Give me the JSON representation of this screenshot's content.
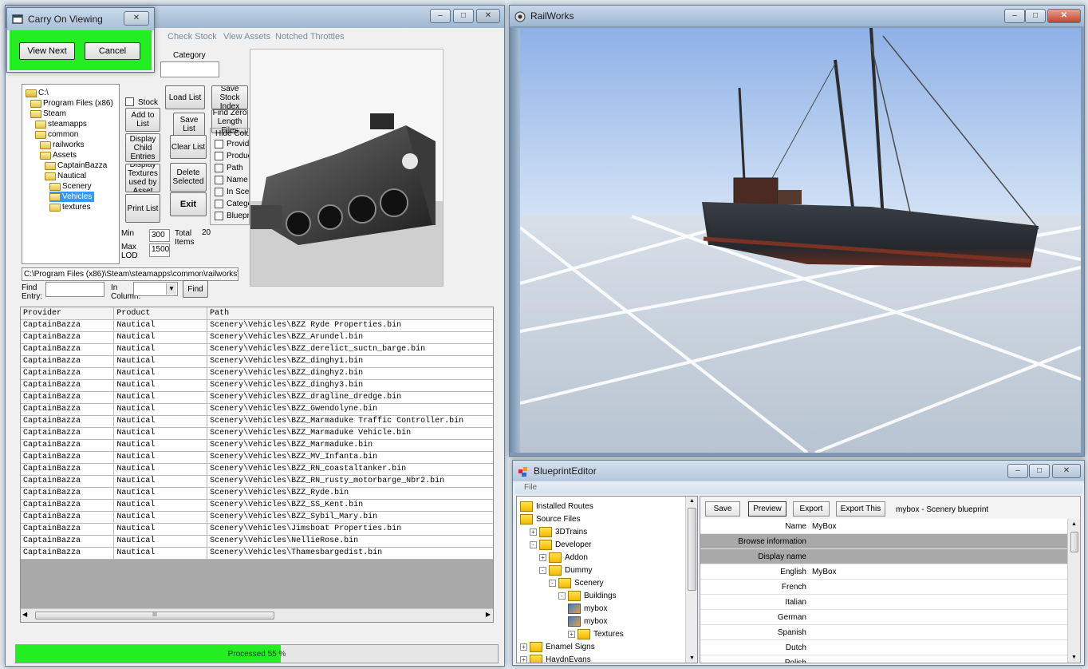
{
  "carry_dialog": {
    "title": "Carry On Viewing",
    "close_glyph": "✕",
    "view_next": "View Next",
    "cancel": "Cancel"
  },
  "main_window": {
    "menu": [
      "Check Stock",
      "View Assets",
      "Notched Throttles"
    ],
    "category_label": "Category",
    "category_value": "",
    "tree": [
      {
        "label": "C:\\",
        "indent": 0
      },
      {
        "label": "Program Files (x86)",
        "indent": 1
      },
      {
        "label": "Steam",
        "indent": 1
      },
      {
        "label": "steamapps",
        "indent": 2
      },
      {
        "label": "common",
        "indent": 2
      },
      {
        "label": "railworks",
        "indent": 3
      },
      {
        "label": "Assets",
        "indent": 3
      },
      {
        "label": "CaptainBazza",
        "indent": 4
      },
      {
        "label": "Nautical",
        "indent": 4
      },
      {
        "label": "Scenery",
        "indent": 5
      },
      {
        "label": "Vehicles",
        "indent": 5,
        "selected": true
      },
      {
        "label": "textures",
        "indent": 5
      }
    ],
    "stock_label": "Stock",
    "buttons": {
      "add_to_list": "Add to List",
      "display_child_entries": "Display Child Entries",
      "display_textures": "Display Textures used by Asset",
      "print_list": "Print List",
      "load_list": "Load List",
      "save_list": "Save List",
      "clear_list": "Clear List",
      "delete_selected": "Delete Selected",
      "exit": "Exit",
      "save_stock_index": "Save Stock Index",
      "find_zero_length": "Find Zero Length Files",
      "find": "Find"
    },
    "hide_columns": {
      "title": "Hide Columns",
      "items": [
        "Provider",
        "Product",
        "Path",
        "Name",
        "In Scenario",
        "Category",
        "Blueprint"
      ]
    },
    "min_label": "Min",
    "min_value": "300",
    "total_label": "Total Items",
    "total_value": "20",
    "max_lod_label": "Max LOD",
    "max_lod_value": "1500",
    "path_value": "C:\\Program Files (x86)\\Steam\\steamapps\\common\\railworks\\Assets",
    "find_entry_label": "Find Entry:",
    "find_entry_value": "",
    "in_column_label": "In Column:",
    "in_column_value": "",
    "table": {
      "headers": [
        "Provider",
        "Product",
        "Path"
      ],
      "rows": [
        [
          "CaptainBazza",
          "Nautical",
          "Scenery\\Vehicles\\BZZ Ryde Properties.bin"
        ],
        [
          "CaptainBazza",
          "Nautical",
          "Scenery\\Vehicles\\BZZ_Arundel.bin"
        ],
        [
          "CaptainBazza",
          "Nautical",
          "Scenery\\Vehicles\\BZZ_derelict_suctn_barge.bin"
        ],
        [
          "CaptainBazza",
          "Nautical",
          "Scenery\\Vehicles\\BZZ_dinghy1.bin"
        ],
        [
          "CaptainBazza",
          "Nautical",
          "Scenery\\Vehicles\\BZZ_dinghy2.bin"
        ],
        [
          "CaptainBazza",
          "Nautical",
          "Scenery\\Vehicles\\BZZ_dinghy3.bin"
        ],
        [
          "CaptainBazza",
          "Nautical",
          "Scenery\\Vehicles\\BZZ_dragline_dredge.bin"
        ],
        [
          "CaptainBazza",
          "Nautical",
          "Scenery\\Vehicles\\BZZ_Gwendolyne.bin"
        ],
        [
          "CaptainBazza",
          "Nautical",
          "Scenery\\Vehicles\\BZZ_Marmaduke Traffic Controller.bin"
        ],
        [
          "CaptainBazza",
          "Nautical",
          "Scenery\\Vehicles\\BZZ_Marmaduke Vehicle.bin"
        ],
        [
          "CaptainBazza",
          "Nautical",
          "Scenery\\Vehicles\\BZZ_Marmaduke.bin"
        ],
        [
          "CaptainBazza",
          "Nautical",
          "Scenery\\Vehicles\\BZZ_MV_Infanta.bin"
        ],
        [
          "CaptainBazza",
          "Nautical",
          "Scenery\\Vehicles\\BZZ_RN_coastaltanker.bin"
        ],
        [
          "CaptainBazza",
          "Nautical",
          "Scenery\\Vehicles\\BZZ_RN_rusty_motorbarge_Nbr2.bin"
        ],
        [
          "CaptainBazza",
          "Nautical",
          "Scenery\\Vehicles\\BZZ_Ryde.bin"
        ],
        [
          "CaptainBazza",
          "Nautical",
          "Scenery\\Vehicles\\BZZ_SS_Kent.bin"
        ],
        [
          "CaptainBazza",
          "Nautical",
          "Scenery\\Vehicles\\BZZ_Sybil_Mary.bin"
        ],
        [
          "CaptainBazza",
          "Nautical",
          "Scenery\\Vehicles\\Jimsboat Properties.bin"
        ],
        [
          "CaptainBazza",
          "Nautical",
          "Scenery\\Vehicles\\NellieRose.bin"
        ],
        [
          "CaptainBazza",
          "Nautical",
          "Scenery\\Vehicles\\Thamesbargedist.bin"
        ]
      ]
    },
    "scroll_thumb_glyph": "III",
    "progress": {
      "text": "Processed 55 %",
      "fraction": 0.55
    }
  },
  "railworks": {
    "title": "RailWorks"
  },
  "blueprint": {
    "title": "BlueprintEditor",
    "menu": "File",
    "tree": [
      {
        "label": "Installed Routes",
        "indent": 0,
        "exp": ""
      },
      {
        "label": "Source Files",
        "indent": 0,
        "exp": ""
      },
      {
        "label": "3DTrains",
        "indent": 1,
        "exp": "+"
      },
      {
        "label": "Developer",
        "indent": 1,
        "exp": "-"
      },
      {
        "label": "Addon",
        "indent": 2,
        "exp": "+"
      },
      {
        "label": "Dummy",
        "indent": 2,
        "exp": "-"
      },
      {
        "label": "Scenery",
        "indent": 3,
        "exp": "-"
      },
      {
        "label": "Buildings",
        "indent": 4,
        "exp": "-"
      },
      {
        "label": "mybox",
        "indent": 5,
        "exp": ""
      },
      {
        "label": "mybox",
        "indent": 5,
        "exp": ""
      },
      {
        "label": "Textures",
        "indent": 5,
        "exp": "+"
      },
      {
        "label": "Enamel Signs",
        "indent": 0,
        "exp": "+"
      },
      {
        "label": "HaydnEvans",
        "indent": 0,
        "exp": "+"
      }
    ],
    "buttons": {
      "save": "Save",
      "preview": "Preview",
      "export": "Export",
      "export_this": "Export This"
    },
    "doc_label": "mybox - Scenery blueprint",
    "properties": [
      {
        "key": "Name",
        "value": "MyBox",
        "section": false
      },
      {
        "key": "Browse information",
        "value": "",
        "section": true
      },
      {
        "key": "Display name",
        "value": "",
        "section": true
      },
      {
        "key": "English",
        "value": "MyBox",
        "section": false
      },
      {
        "key": "French",
        "value": "",
        "section": false
      },
      {
        "key": "Italian",
        "value": "",
        "section": false
      },
      {
        "key": "German",
        "value": "",
        "section": false
      },
      {
        "key": "Spanish",
        "value": "",
        "section": false
      },
      {
        "key": "Dutch",
        "value": "",
        "section": false
      },
      {
        "key": "Polish",
        "value": "",
        "section": false
      }
    ]
  },
  "window_controls": {
    "minimize": "–",
    "maximize": "□",
    "close": "✕"
  },
  "colors": {
    "accent_green": "#22ee22",
    "selection_blue": "#3399ff",
    "sky": "#bcd2ef",
    "ground": "#c9d2dd"
  }
}
